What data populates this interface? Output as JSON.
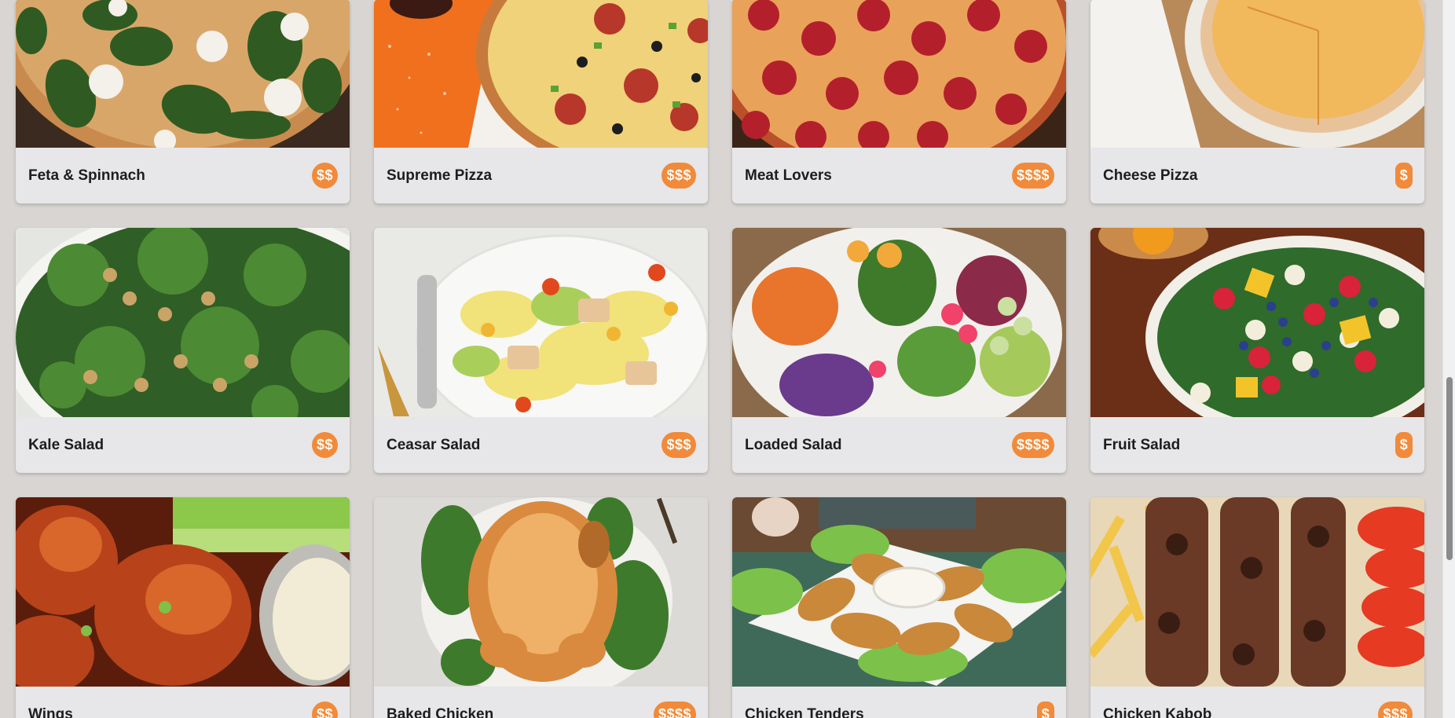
{
  "menu": {
    "rows": [
      {
        "items": [
          {
            "name": "Feta & Spinnach",
            "price": "$$",
            "image": "pizza-feta-spinach-icon"
          },
          {
            "name": "Supreme Pizza",
            "price": "$$$",
            "image": "pizza-supreme-icon"
          },
          {
            "name": "Meat Lovers",
            "price": "$$$$",
            "image": "pizza-pepperoni-icon"
          },
          {
            "name": "Cheese Pizza",
            "price": "$",
            "image": "pizza-cheese-icon"
          }
        ]
      },
      {
        "items": [
          {
            "name": "Kale Salad",
            "price": "$$",
            "image": "salad-kale-icon"
          },
          {
            "name": "Ceasar Salad",
            "price": "$$$",
            "image": "salad-caesar-icon"
          },
          {
            "name": "Loaded Salad",
            "price": "$$$$",
            "image": "salad-loaded-icon"
          },
          {
            "name": "Fruit Salad",
            "price": "$",
            "image": "salad-fruit-icon"
          }
        ]
      },
      {
        "items": [
          {
            "name": "Wings",
            "price": "$$",
            "image": "wings-icon"
          },
          {
            "name": "Baked Chicken",
            "price": "$$$$",
            "image": "baked-chicken-icon"
          },
          {
            "name": "Chicken Tenders",
            "price": "$",
            "image": "chicken-tenders-icon"
          },
          {
            "name": "Chicken Kabob",
            "price": "$$$",
            "image": "chicken-kabob-icon"
          }
        ]
      }
    ]
  },
  "colors": {
    "page_background": "#d8d5d2",
    "card_background": "#e7e6e8",
    "price_badge": "#f18a3a",
    "title_text": "#1d1d1d"
  }
}
